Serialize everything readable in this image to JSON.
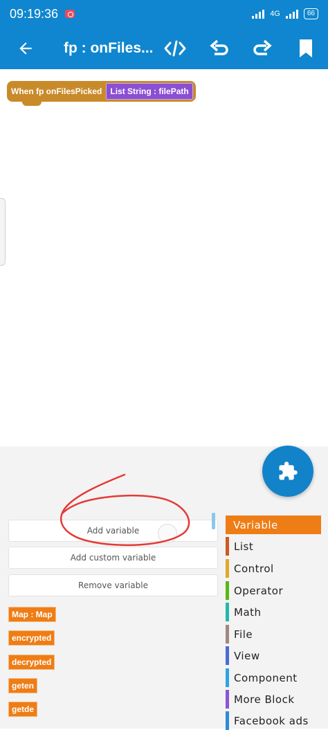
{
  "status": {
    "time": "09:19:36",
    "network": "4G",
    "battery": "66"
  },
  "appbar": {
    "title": "fp : onFiles...",
    "icons": [
      "back-arrow-icon",
      "code-icon",
      "undo-icon",
      "redo-icon",
      "bookmark-icon"
    ]
  },
  "canvas": {
    "event_block": {
      "label": "When fp onFilesPicked",
      "param": "List String : filePath"
    }
  },
  "palette": {
    "add_variable": "Add variable",
    "add_custom_variable": "Add custom variable",
    "remove_variable": "Remove variable",
    "variables": [
      "Map : Map",
      "encrypted",
      "decrypted",
      "geten",
      "getde"
    ]
  },
  "categories": [
    {
      "label": "Variable",
      "color": "#ee7d16",
      "selected": true
    },
    {
      "label": "List",
      "color": "#cc5b22"
    },
    {
      "label": "Control",
      "color": "#e1a92a"
    },
    {
      "label": "Operator",
      "color": "#5cb712"
    },
    {
      "label": "Math",
      "color": "#23b9a9"
    },
    {
      "label": "File",
      "color": "#a1887f"
    },
    {
      "label": "View",
      "color": "#4a6cd4"
    },
    {
      "label": "Component",
      "color": "#2ca5e2"
    },
    {
      "label": "More Block",
      "color": "#8a55d7"
    },
    {
      "label": "Facebook ads",
      "color": "#2e8bd6"
    }
  ],
  "colors": {
    "primary": "#0f86cf",
    "annotation": "#e53935"
  }
}
